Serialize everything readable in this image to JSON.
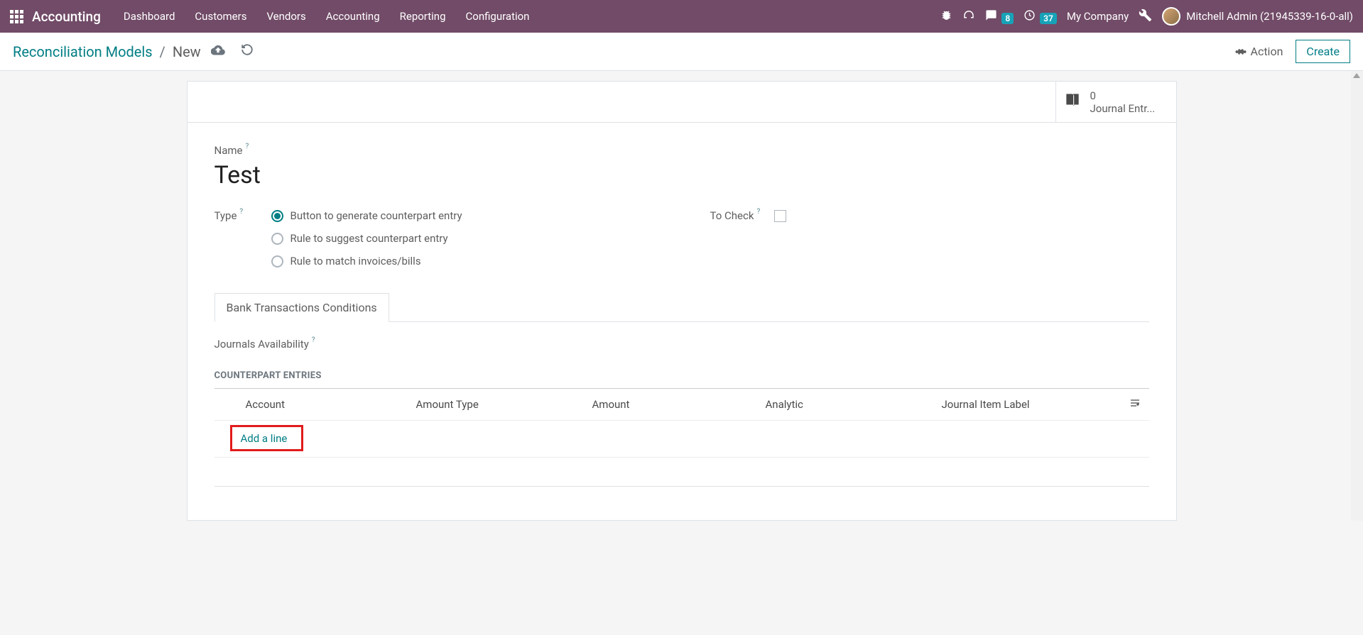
{
  "topbar": {
    "app_name": "Accounting",
    "nav": [
      "Dashboard",
      "Customers",
      "Vendors",
      "Accounting",
      "Reporting",
      "Configuration"
    ],
    "messages_badge": "8",
    "timer_badge": "37",
    "company": "My Company",
    "user": "Mitchell Admin (21945339-16-0-all)"
  },
  "breadcrumb": {
    "parent": "Reconciliation Models",
    "current": "New",
    "action_label": "Action",
    "create_label": "Create"
  },
  "stat": {
    "count": "0",
    "label": "Journal Entr..."
  },
  "form": {
    "name_label": "Name",
    "name_value": "Test",
    "type_label": "Type",
    "type_options": [
      "Button to generate counterpart entry",
      "Rule to suggest counterpart entry",
      "Rule to match invoices/bills"
    ],
    "to_check_label": "To Check",
    "tab_label": "Bank Transactions Conditions",
    "journals_label": "Journals Availability",
    "section_heading": "COUNTERPART ENTRIES",
    "columns": {
      "account": "Account",
      "amount_type": "Amount Type",
      "amount": "Amount",
      "analytic": "Analytic",
      "journal_item_label": "Journal Item Label"
    },
    "add_line": "Add a line"
  }
}
